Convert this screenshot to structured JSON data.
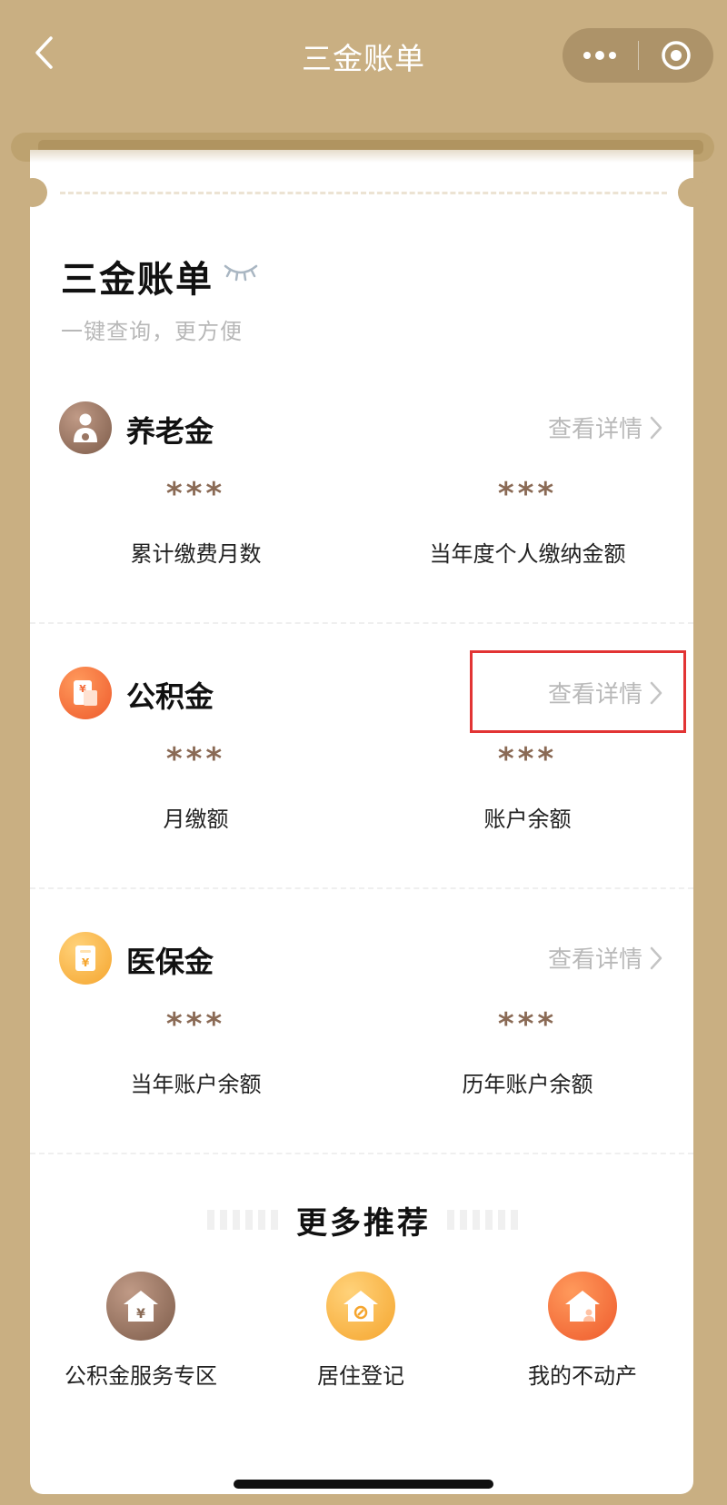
{
  "navbar": {
    "title": "三金账单"
  },
  "header": {
    "title": "三金账单",
    "subtitle": "一键查询，更方便"
  },
  "sections": [
    {
      "name": "养老金",
      "link": "查看详情",
      "icon": "pension-person-icon",
      "color": "#8a6a55",
      "stats": [
        {
          "value": "***",
          "label": "累计缴费月数"
        },
        {
          "value": "***",
          "label": "当年度个人缴纳金额"
        }
      ]
    },
    {
      "name": "公积金",
      "link": "查看详情",
      "icon": "housing-fund-card-icon",
      "color": "#f46d3b",
      "stats": [
        {
          "value": "***",
          "label": "月缴额"
        },
        {
          "value": "***",
          "label": "账户余额"
        }
      ]
    },
    {
      "name": "医保金",
      "link": "查看详情",
      "icon": "medical-insurance-card-icon",
      "color": "#f8b13e",
      "stats": [
        {
          "value": "***",
          "label": "当年账户余额"
        },
        {
          "value": "***",
          "label": "历年账户余额"
        }
      ]
    }
  ],
  "more": {
    "title": "更多推荐",
    "items": [
      {
        "label": "公积金服务专区",
        "icon": "house-yuan-icon"
      },
      {
        "label": "居住登记",
        "icon": "house-pin-icon"
      },
      {
        "label": "我的不动产",
        "icon": "house-person-icon"
      }
    ]
  },
  "colors": {
    "background": "#C9AF82",
    "stat_value": "#8a6a55",
    "highlight": "#e23434"
  }
}
